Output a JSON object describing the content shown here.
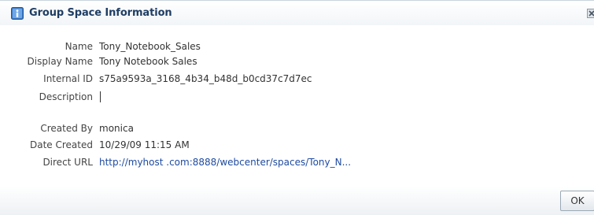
{
  "dialog": {
    "title": "Group Space Information",
    "icon": "info-icon",
    "close_icon": "close-icon"
  },
  "fields": {
    "name": {
      "label": "Name",
      "value": "Tony_Notebook_Sales"
    },
    "display_name": {
      "label": "Display Name",
      "value": "Tony Notebook Sales"
    },
    "internal_id": {
      "label": "Internal ID",
      "value": "s75a9593a_3168_4b34_b48d_b0cd37c7d7ec"
    },
    "description": {
      "label": "Description",
      "value": ""
    },
    "created_by": {
      "label": "Created By",
      "value": "monica"
    },
    "date_created": {
      "label": "Date Created",
      "value": "10/29/09 11:15 AM"
    },
    "direct_url": {
      "label": "Direct URL",
      "value": "http://myhost .com:8888/webcenter/spaces/Tony_N..."
    }
  },
  "footer": {
    "ok_label": "OK"
  },
  "colors": {
    "title": "#1f3d63",
    "link": "#1e4ba0",
    "label": "#444444"
  }
}
